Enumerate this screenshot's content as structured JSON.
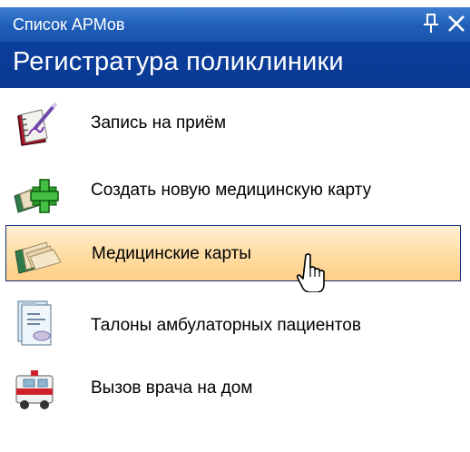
{
  "window": {
    "title": "Список АРМов",
    "pin_glyph": "ᛘ",
    "close_glyph": "✕"
  },
  "header": {
    "title": "Регистратура поликлиники"
  },
  "items": [
    {
      "label": "Запись на приём",
      "icon": "appointment-book-icon"
    },
    {
      "label": "Создать новую медицинскую карту",
      "icon": "new-medical-card-icon"
    },
    {
      "label": "Медицинские карты",
      "icon": "medical-cards-icon",
      "active": true
    },
    {
      "label": "Талоны амбулаторных пациентов",
      "icon": "outpatient-coupons-icon"
    },
    {
      "label": "Вызов врача на дом",
      "icon": "ambulance-icon"
    }
  ],
  "colors": {
    "titlebar": "#1f5eb8",
    "header": "#0b3f9e",
    "highlight": "#ffe1ad",
    "highlight_border": "#0c2e77"
  }
}
